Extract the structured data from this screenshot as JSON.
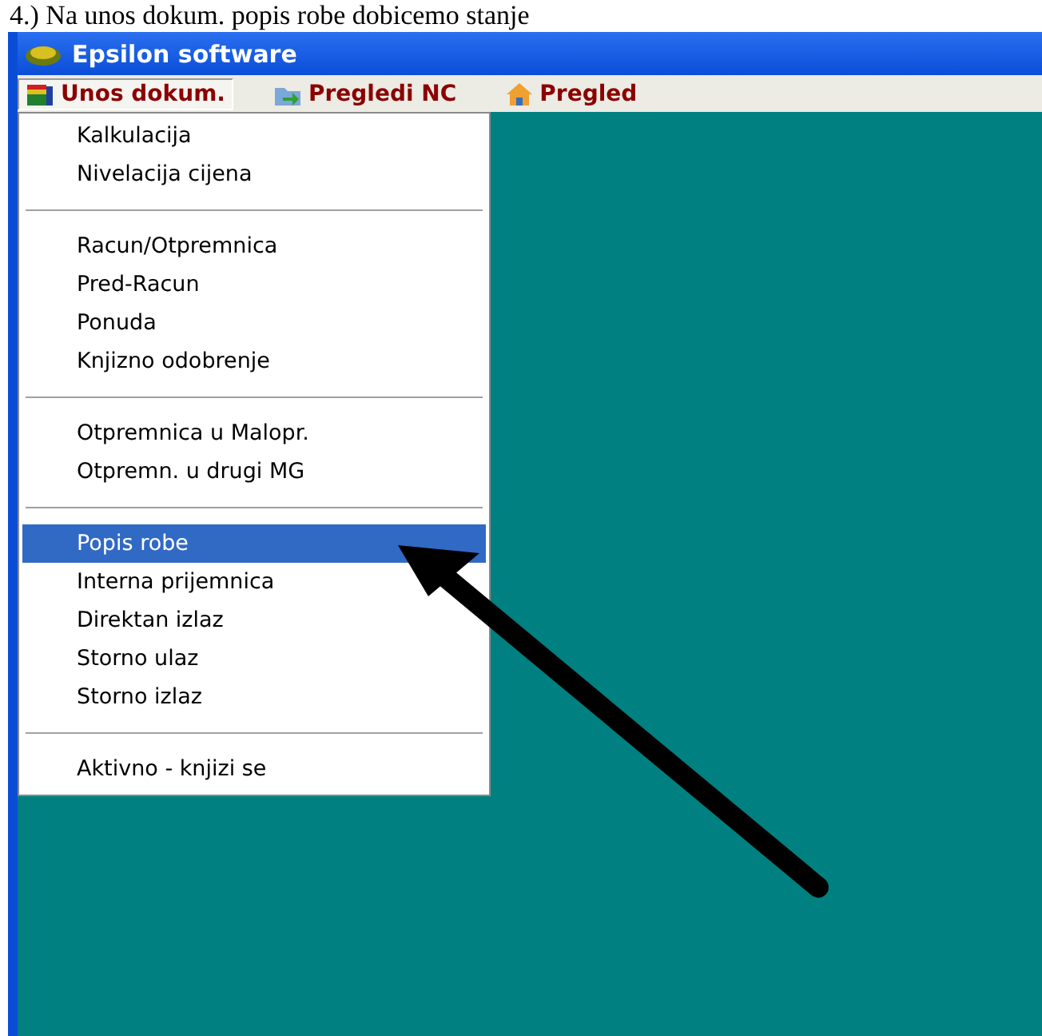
{
  "caption": "4.) Na unos dokum. popis robe dobicemo stanje",
  "window": {
    "title": "Epsilon software"
  },
  "menu_bar": [
    {
      "label": "Unos dokum.",
      "selected": true
    },
    {
      "label": "Pregledi NC",
      "selected": false
    },
    {
      "label": "Pregled",
      "selected": false
    }
  ],
  "dropdown": [
    {
      "kind": "item",
      "label": "Kalkulacija",
      "selected": false
    },
    {
      "kind": "item",
      "label": "Nivelacija cijena",
      "selected": false
    },
    {
      "kind": "separator"
    },
    {
      "kind": "item",
      "label": "Racun/Otpremnica",
      "selected": false
    },
    {
      "kind": "item",
      "label": "Pred-Racun",
      "selected": false
    },
    {
      "kind": "item",
      "label": "Ponuda",
      "selected": false
    },
    {
      "kind": "item",
      "label": "Knjizno odobrenje",
      "selected": false
    },
    {
      "kind": "separator"
    },
    {
      "kind": "item",
      "label": "Otpremnica u Malopr.",
      "selected": false
    },
    {
      "kind": "item",
      "label": "Otpremn. u drugi MG",
      "selected": false
    },
    {
      "kind": "separator"
    },
    {
      "kind": "item",
      "label": "Popis robe",
      "selected": true
    },
    {
      "kind": "item",
      "label": "Interna prijemnica",
      "selected": false
    },
    {
      "kind": "item",
      "label": "Direktan izlaz",
      "selected": false
    },
    {
      "kind": "item",
      "label": "Storno ulaz",
      "selected": false
    },
    {
      "kind": "item",
      "label": "Storno izlaz",
      "selected": false
    },
    {
      "kind": "separator"
    },
    {
      "kind": "item",
      "label": "Aktivno - knjizi se",
      "selected": false
    }
  ]
}
